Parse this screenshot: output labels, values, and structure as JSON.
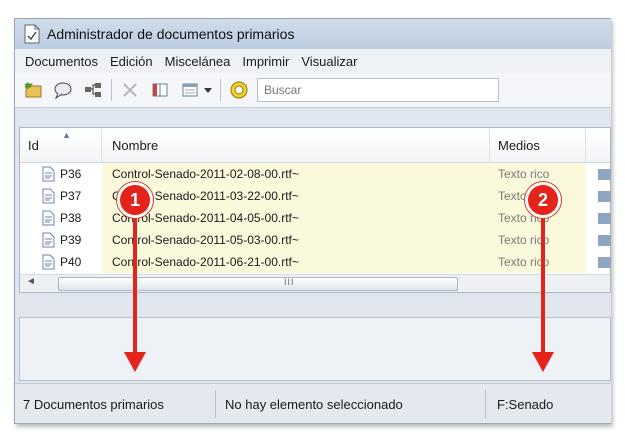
{
  "window": {
    "title": "Administrador de documentos primarios"
  },
  "menu": [
    "Documentos",
    "Edición",
    "Miscelánea",
    "Imprimir",
    "Visualizar"
  ],
  "toolbar": {
    "search_placeholder": "Buscar",
    "icons": [
      "new-document-icon",
      "comment-icon",
      "family-tree-icon",
      "delete-icon",
      "split-view-icon",
      "view-options-icon",
      "dropdown-arrow-icon",
      "search-ring-icon"
    ]
  },
  "list": {
    "columns": {
      "id": "Id",
      "name": "Nombre",
      "media": "Medios"
    },
    "rows": [
      {
        "id": "P36",
        "name": "Control-Senado-2011-02-08-00.rtf~",
        "media": "Texto rico"
      },
      {
        "id": "P37",
        "name": "Control-Senado-2011-03-22-00.rtf~",
        "media": "Texto rico"
      },
      {
        "id": "P38",
        "name": "Control-Senado-2011-04-05-00.rtf~",
        "media": "Texto rico"
      },
      {
        "id": "P39",
        "name": "Control-Senado-2011-05-03-00.rtf~",
        "media": "Texto rico"
      },
      {
        "id": "P40",
        "name": "Control-Senado-2011-06-21-00.rtf~",
        "media": "Texto rico"
      }
    ],
    "scroll_grip": "III",
    "left_arrow": "◄"
  },
  "status": {
    "count": "7 Documentos primarios",
    "selection": "No hay elemento seleccionado",
    "filter": "F:Senado"
  },
  "callouts": {
    "one": "1",
    "two": "2"
  },
  "colors": {
    "callout": "#e4231b",
    "row_highlight": "#fbf9dc",
    "titlebar": "#bccde0"
  }
}
